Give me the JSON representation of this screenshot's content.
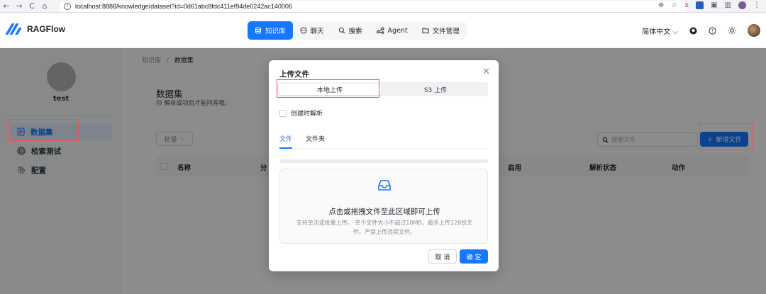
{
  "browser": {
    "url": "localhost:8888/knowledge/dataset?id=0d61abc8fdc411ef94de0242ac140006",
    "back_icon": "←",
    "forward_icon": "→",
    "reload_icon": "C",
    "home_icon": "⌂"
  },
  "header": {
    "brand": "RAGFlow",
    "nav": [
      {
        "label": "知识库",
        "icon": "database-icon"
      },
      {
        "label": "聊天",
        "icon": "chat-icon"
      },
      {
        "label": "搜索",
        "icon": "search-icon"
      },
      {
        "label": "Agent",
        "icon": "agent-icon"
      },
      {
        "label": "文件管理",
        "icon": "folder-icon"
      }
    ],
    "language": "简体中文",
    "accent_color": "#1677ff"
  },
  "sidebar": {
    "kb_name": "test",
    "items": [
      {
        "label": "数据集",
        "icon": "file-text-icon"
      },
      {
        "label": "检索测试",
        "icon": "target-icon"
      },
      {
        "label": "配置",
        "icon": "gear-icon"
      }
    ]
  },
  "main": {
    "breadcrumb": [
      "知识库",
      "数据集"
    ],
    "breadcrumb_sep": "/",
    "title": "数据集",
    "description": "😉 解析成功后才能问答哦。",
    "bulk_label": "批量",
    "search_placeholder": "搜索文件",
    "add_file_label": "新增文件",
    "columns": [
      "名称",
      "分",
      "启用",
      "解析状态",
      "动作"
    ]
  },
  "modal": {
    "title": "上传文件",
    "segments": [
      "本地上传",
      "S3 上传"
    ],
    "parse_on_create": "创建时解析",
    "tabs": [
      "文件",
      "文件夹"
    ],
    "progress": 0,
    "dropzone_main": "点击或拖拽文件至此区域即可上传",
    "dropzone_hint": "支持单次或批量上传。 单个文件大小不超过10MB，最多上传128份文件。严禁上传违禁文件。",
    "cancel": "取 消",
    "ok": "确 定"
  }
}
